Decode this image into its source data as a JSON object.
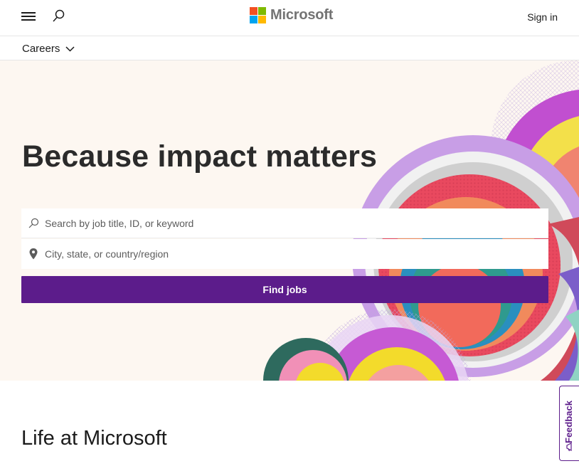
{
  "header": {
    "brand": "Microsoft",
    "sign_in": "Sign in",
    "menu_icon": "hamburger-menu-icon",
    "search_icon": "search-icon"
  },
  "subnav": {
    "section": "Careers",
    "expand_icon": "chevron-down-icon"
  },
  "hero": {
    "title": "Because impact matters",
    "keyword_placeholder": "Search by job title, ID, or keyword",
    "location_placeholder": "City, state, or country/region",
    "find_button": "Find jobs"
  },
  "section": {
    "heading": "Life at Microsoft"
  },
  "feedback": {
    "label": "Feedback"
  },
  "colors": {
    "accent": "#5c1c8b",
    "hero_bg": "#fdf7f1",
    "logo_red": "#f25022",
    "logo_green": "#7fba00",
    "logo_blue": "#00a4ef",
    "logo_yellow": "#ffb900"
  }
}
